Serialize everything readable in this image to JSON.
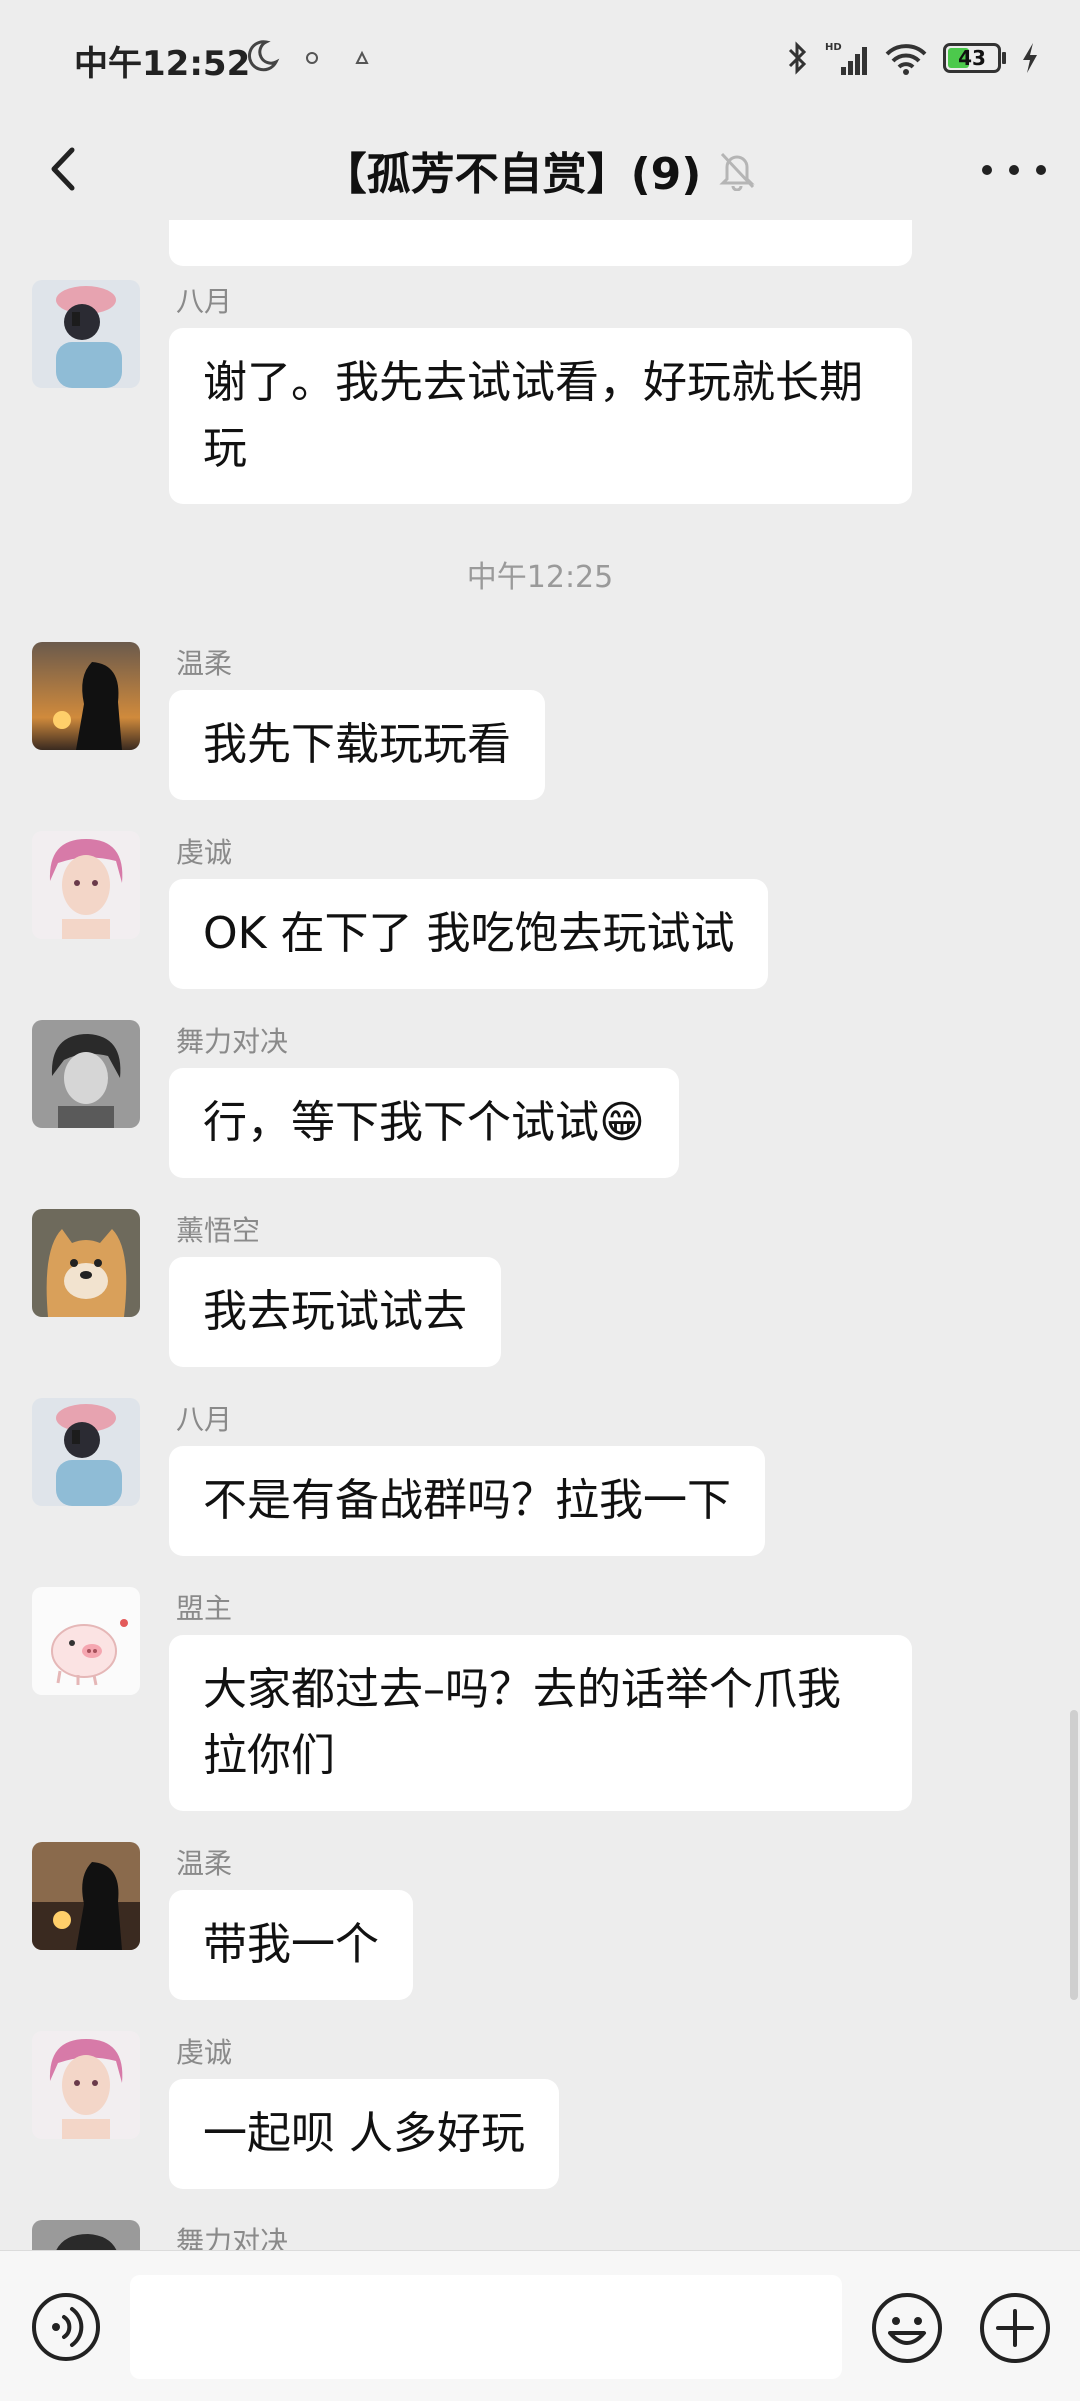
{
  "status_bar": {
    "time": "中午12:52",
    "battery": "43",
    "battery_level": 0.43,
    "icons": [
      "moon-icon",
      "notification-icon",
      "notification-icon",
      "bluetooth-icon",
      "hd-signal-icon",
      "wifi-icon",
      "battery-icon",
      "charging-icon"
    ]
  },
  "header": {
    "title": "【孤芳不自赏】(9)",
    "icons": [
      "back-arrow-icon",
      "mute-bell-icon",
      "more-icon"
    ]
  },
  "chat": {
    "time_separator": "中午12:25",
    "messages": [
      {
        "sender": "八月",
        "text": "谢了。我先去试试看，好玩就长期玩",
        "avatar": "avatar-bayue"
      },
      {
        "sender": "温柔",
        "text": "我先下载玩玩看",
        "avatar": "avatar-wenrou"
      },
      {
        "sender": "虔诚",
        "text": "OK 在下了 我吃饱去玩试试",
        "avatar": "avatar-qiancheng"
      },
      {
        "sender": "舞力对决",
        "text": "行，等下我下个试试😁",
        "avatar": "avatar-wulidujue"
      },
      {
        "sender": "薰悟空",
        "text": "我去玩试试去",
        "avatar": "avatar-xunwukong"
      },
      {
        "sender": "八月",
        "text": "不是有备战群吗？拉我一下",
        "avatar": "avatar-bayue"
      },
      {
        "sender": "盟主",
        "text": "大家都过去–吗？去的话举个爪我拉你们",
        "avatar": "avatar-mengzhu"
      },
      {
        "sender": "温柔",
        "text": "带我一个",
        "avatar": "avatar-wenrou"
      },
      {
        "sender": "虔诚",
        "text": "一起呗 人多好玩",
        "avatar": "avatar-qiancheng"
      },
      {
        "sender": "舞力对决",
        "text": "",
        "avatar": "avatar-wulidujue"
      }
    ]
  },
  "input_bar": {
    "value": "",
    "icons": [
      "voice-icon",
      "emoji-icon",
      "plus-icon"
    ]
  },
  "colors": {
    "background": "#ededed",
    "bubble": "#ffffff",
    "sender_text": "#8a8a8a",
    "battery_green": "#4cc94c"
  }
}
